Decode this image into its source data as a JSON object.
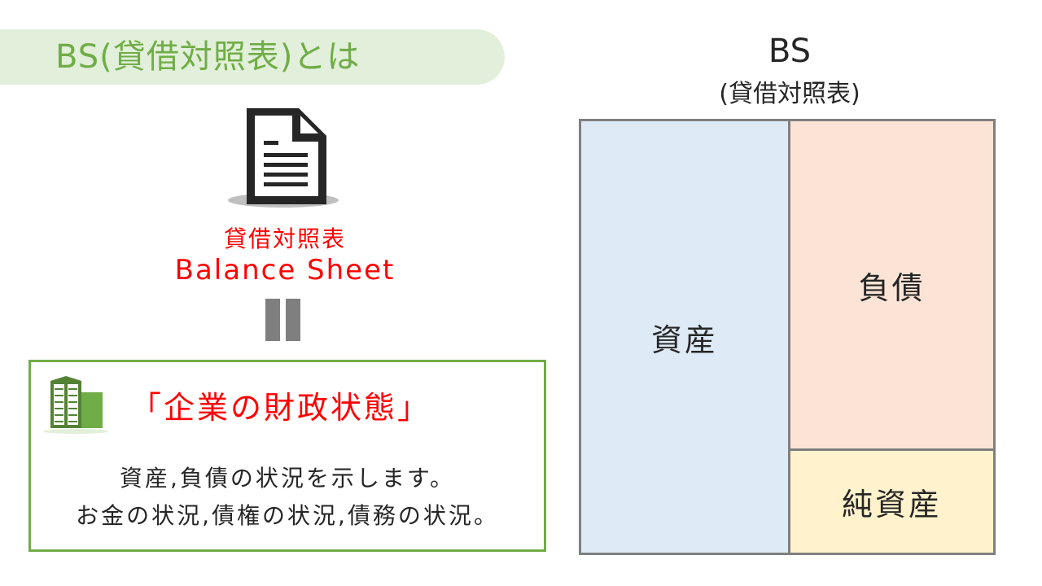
{
  "header": {
    "title": "BS(貸借対照表)とは"
  },
  "left": {
    "icon": "document-icon",
    "term_jp": "貸借対照表",
    "term_en": "Balance Sheet",
    "equals_icon": "equals-sign-icon",
    "box": {
      "icon": "building-icon",
      "title": "「企業の財政状態」",
      "lines": [
        "資産,負債の状況を示します。",
        "お金の状況,債権の状況,債務の状況。"
      ]
    }
  },
  "right": {
    "title": "BS",
    "subtitle": "(貸借対照表)",
    "cells": {
      "assets": "資産",
      "liabilities": "負債",
      "equity": "純資産"
    }
  },
  "colors": {
    "accent_green": "#70ad47",
    "banner_bg": "#e2efda",
    "highlight_red": "#ff0000",
    "assets_bg": "#deeaf6",
    "liabilities_bg": "#fbe4d6",
    "equity_bg": "#fff2cc",
    "border_gray": "#7f7f7f"
  }
}
